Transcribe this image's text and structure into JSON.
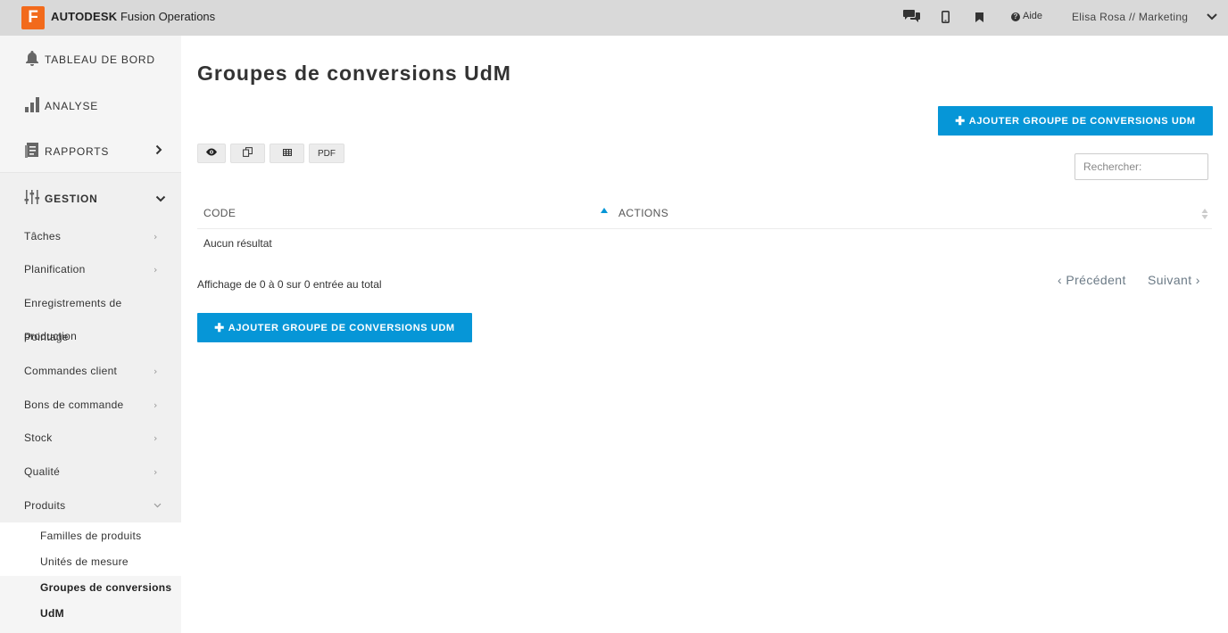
{
  "topbar": {
    "logo_letter": "F",
    "brand": "AUTODESK",
    "product": "Fusion Operations",
    "help_label": "Aide",
    "user_label": "Elisa Rosa // Marketing",
    "icons": [
      "chat-icon",
      "mobile-icon",
      "bookmark-icon",
      "help-icon",
      "chevron-down-icon"
    ]
  },
  "sidebar": {
    "top_items": [
      {
        "label": "TABLEAU DE BORD",
        "icon": "bell-icon"
      },
      {
        "label": "ANALYSE",
        "icon": "bar-chart-icon"
      },
      {
        "label": "RAPPORTS",
        "icon": "report-icon"
      },
      {
        "label": "GESTION",
        "icon": "sliders-icon"
      }
    ],
    "items": [
      {
        "label": "Tâches"
      },
      {
        "label": "Planification"
      },
      {
        "label": "Enregistrements de"
      },
      {
        "label": "production"
      },
      {
        "label": "Pointage"
      },
      {
        "label": "Commandes client"
      },
      {
        "label": "Bons de commande"
      },
      {
        "label": "Stock"
      },
      {
        "label": "Qualité"
      },
      {
        "label": "Produits"
      }
    ],
    "sub_items": [
      {
        "label": "Familles de produits"
      },
      {
        "label": "Unités de mesure"
      },
      {
        "label": "Groupes de conversions"
      },
      {
        "label": "UdM"
      }
    ]
  },
  "main": {
    "title": "Groupes de conversions UdM",
    "add_button_label": "AJOUTER GROUPE DE CONVERSIONS UDM",
    "toolbar": {
      "pdf_label": "PDF"
    },
    "search_placeholder": "Rechercher:",
    "table": {
      "columns": [
        "CODE",
        "ACTIONS"
      ],
      "empty_text": "Aucun résultat"
    },
    "info_text": "Affichage de 0 à 0 sur 0 entrée au total",
    "pager": {
      "previous": "Précédent",
      "next": "Suivant"
    }
  },
  "colors": {
    "accent": "#0696d7",
    "brand": "#f26a1b",
    "topbar": "#d9d9d9",
    "sidebar": "#f5f5f5"
  }
}
